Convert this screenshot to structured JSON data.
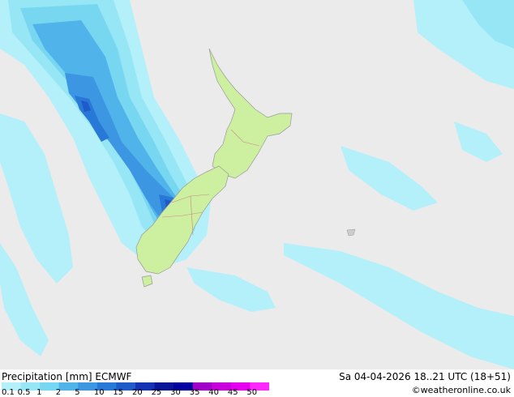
{
  "map": {
    "colors": {
      "sea": "#ebebeb",
      "land": "#ccf0a0",
      "coast": "#999999",
      "border": "#cc8888"
    },
    "precip_levels": [
      {
        "value": 0.1,
        "color": "#b4f0fa"
      },
      {
        "value": 0.5,
        "color": "#96e6f5"
      },
      {
        "value": 1,
        "color": "#78d7f0"
      },
      {
        "value": 2,
        "color": "#50b4eb"
      },
      {
        "value": 5,
        "color": "#3c96e1"
      },
      {
        "value": 10,
        "color": "#2878d7"
      },
      {
        "value": 15,
        "color": "#1e5ac8"
      },
      {
        "value": 20,
        "color": "#1432b4"
      },
      {
        "value": 25,
        "color": "#0a1496"
      },
      {
        "value": 30,
        "color": "#0000a0"
      },
      {
        "value": 35,
        "color": "#a000c8"
      },
      {
        "value": 40,
        "color": "#c800dc"
      },
      {
        "value": 45,
        "color": "#e600f0"
      },
      {
        "value": 50,
        "color": "#ff28ff"
      }
    ]
  },
  "footer": {
    "title": "Precipitation [mm]  ECMWF",
    "datetime": "Sa 04-04-2026 18..21 UTC (18+51)",
    "credit": "©weatheronline.co.uk",
    "scale_labels": [
      "0.1",
      "0.5",
      "1",
      "2",
      "5",
      "10",
      "15",
      "20",
      "25",
      "30",
      "35",
      "40",
      "45",
      "50"
    ]
  }
}
